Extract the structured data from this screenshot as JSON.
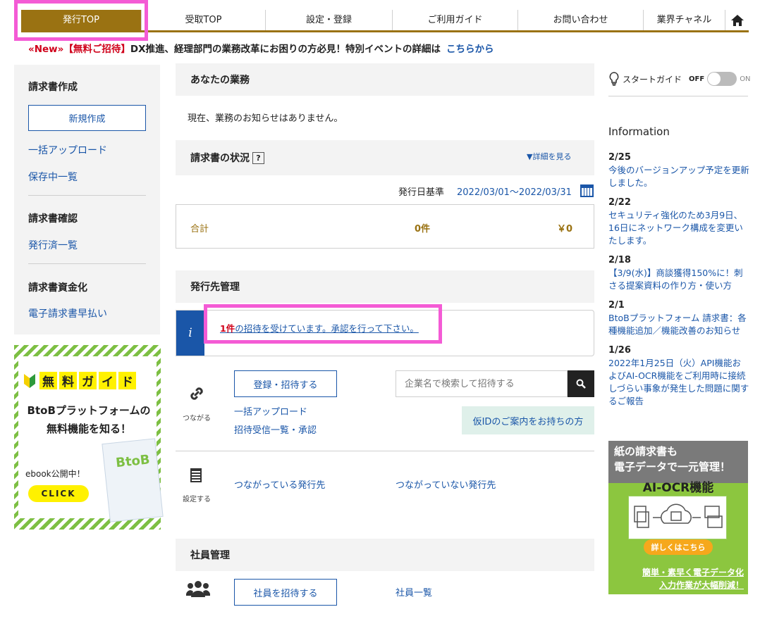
{
  "nav": {
    "items": [
      "発行TOP",
      "受取TOP",
      "設定・登録",
      "ご利用ガイド",
      "お問い合わせ",
      "業界チャネル"
    ],
    "home_icon": "home-icon"
  },
  "news": {
    "new_tag": "«New»",
    "invite_tag": "【無料ご招待】",
    "text": "DX推進、経理部門の業務改革にお困りの方必見！特別イベントの詳細は",
    "link": "こちらから"
  },
  "sidebar": {
    "invoice_create_head": "請求書作成",
    "new_button": "新規作成",
    "bulk_upload": "一括アップロード",
    "saved_list": "保存中一覧",
    "invoice_confirm_head": "請求書確認",
    "issued_list": "発行済一覧",
    "funding_head": "請求書資金化",
    "early_payment": "電子請求書早払い"
  },
  "guide_banner": {
    "title_chars": [
      "無",
      "料",
      "ガ",
      "イ",
      "ド"
    ],
    "sub1": "BtoBプラットフォームの",
    "sub2": "無料機能を知る！",
    "ebook": "ebook公開中！",
    "click": "CLICK",
    "book": "BtoB"
  },
  "tasks": {
    "head": "あなたの業務",
    "empty": "現在、業務のお知らせはありません。"
  },
  "status": {
    "head": "請求書の状況",
    "detail_link": "▼詳細を見る",
    "basis_label": "発行日基準",
    "range": "2022/03/01～2022/03/31",
    "total_label": "合計",
    "count": "0件",
    "amount": "￥0"
  },
  "partners": {
    "head": "発行先管理",
    "invite_count": "1件",
    "invite_text": "の招待を受けています。承認を行って下さい。",
    "connect_caption": "つながる",
    "register_button": "登録・招待する",
    "bulk_upload": "一括アップロード",
    "invite_list": "招待受信一覧・承認",
    "search_placeholder": "企業名で検索して招待する",
    "temp_id_button": "仮IDのご案内をお持ちの方",
    "settings_caption": "設定する",
    "connected": "つながっている発行先",
    "not_connected": "つながっていない発行先"
  },
  "staff": {
    "head": "社員管理",
    "invite_button": "社員を招待する",
    "list": "社員一覧"
  },
  "right": {
    "start_guide": "スタートガイド",
    "off": "OFF",
    "on": "ON",
    "info_title": "Information",
    "news": [
      {
        "date": "2/25",
        "text": "今後のバージョンアップ予定を更新しました。"
      },
      {
        "date": "2/22",
        "text": "セキュリティ強化のため3月9日、16日にネットワーク構成を変更いたします。"
      },
      {
        "date": "2/18",
        "text": "【3/9(水)】商談獲得150%に！刺さる提案資料の作り方・使い方"
      },
      {
        "date": "2/1",
        "text": "BtoBプラットフォーム 請求書：各種機能追加／機能改善のお知らせ"
      },
      {
        "date": "1/26",
        "text": "2022年1月25日（火）API機能およびAI-OCR機能をご利用時に接続しづらい事象が発生した問題に関するご報告"
      }
    ]
  },
  "ocr_banner": {
    "line1": "紙の請求書も",
    "line2": "電子データで一元管理！",
    "title": "AI-OCR機能",
    "cta": "詳しくはこちら",
    "foot1": "簡単・素早く電子データ化",
    "foot2": "入力作業が大幅削減！"
  }
}
